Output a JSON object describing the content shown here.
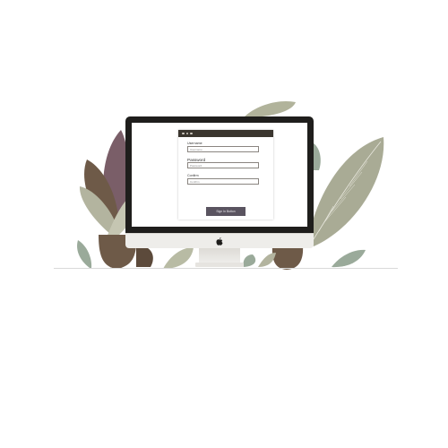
{
  "window": {
    "title_dots": 3,
    "fields": [
      {
        "label": "Username",
        "placeholder": "Username"
      },
      {
        "label": "Password",
        "placeholder": "Password"
      },
      {
        "label": "Confirm",
        "placeholder": "Confirm"
      }
    ],
    "submit_label": "Sign In Button"
  },
  "icons": {
    "brand": "apple-icon"
  },
  "colors": {
    "bezel": "#1f1e1c",
    "titlebar": "#3b362f",
    "button": "#5a5460",
    "leaf_sage": "#a9ab95",
    "leaf_brown": "#6e5a48",
    "leaf_plum": "#7a5e68"
  }
}
